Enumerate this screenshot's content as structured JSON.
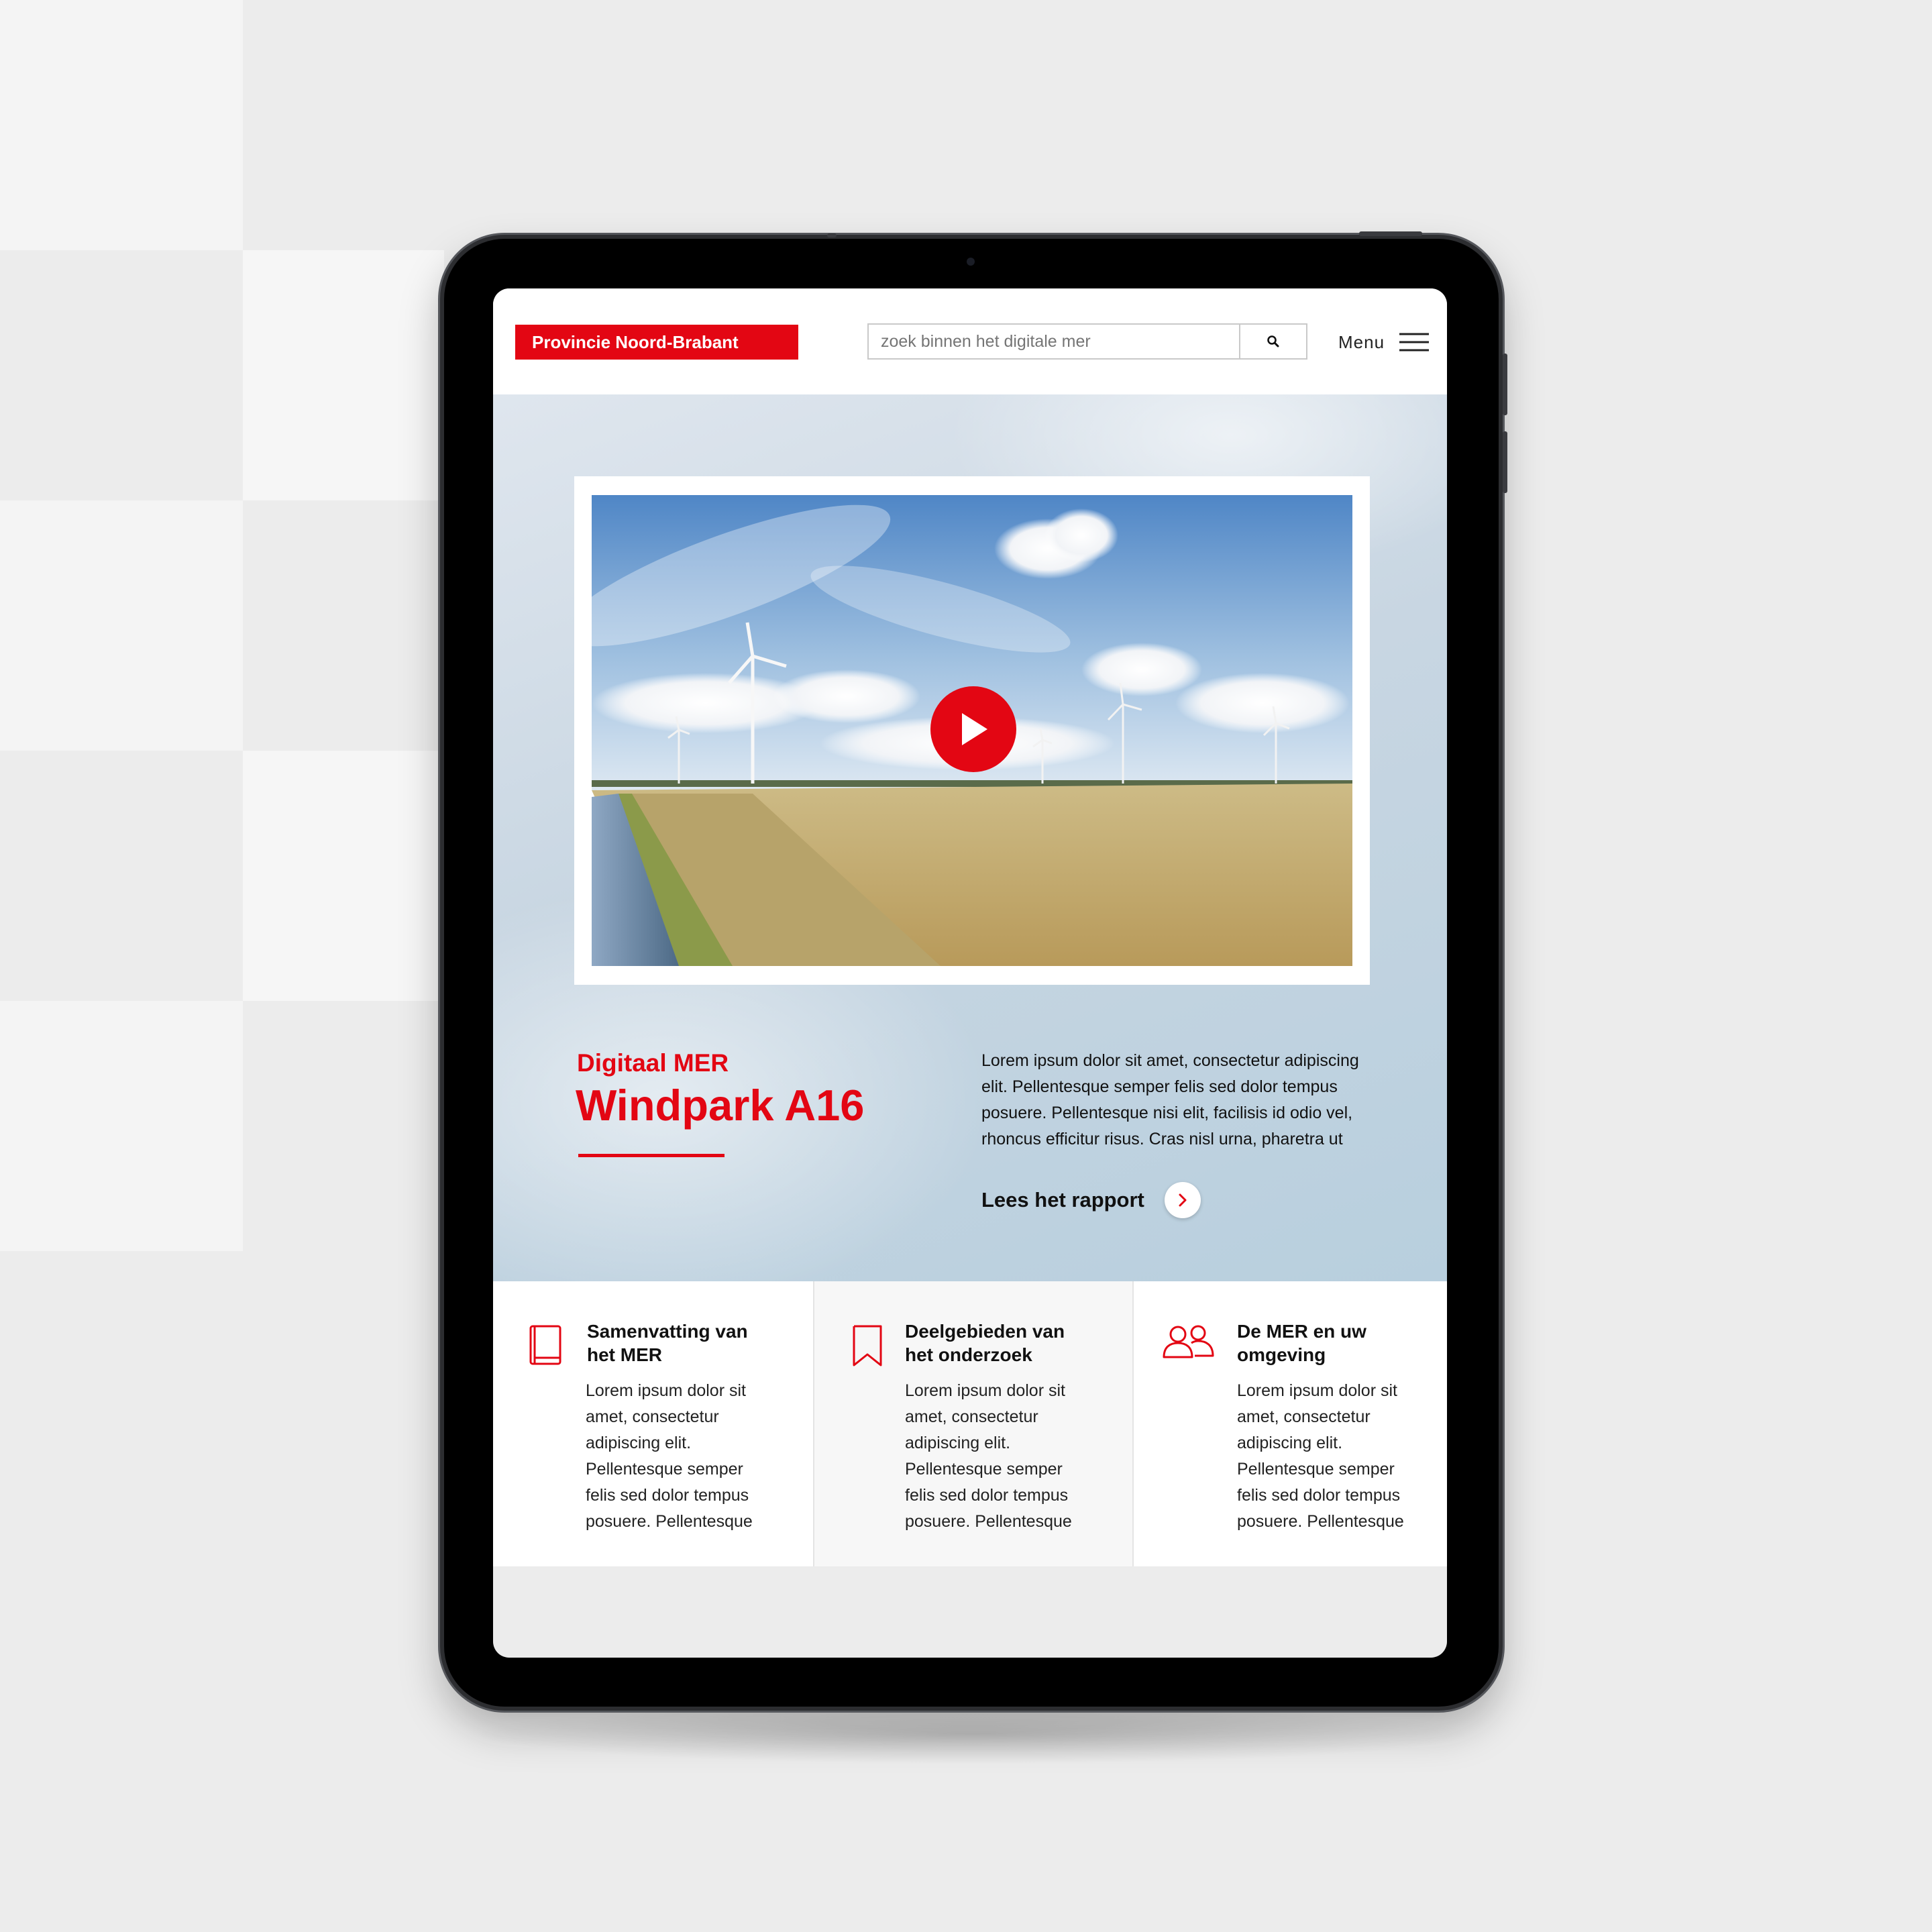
{
  "header": {
    "logo_text": "Provincie Noord-Brabant",
    "search_placeholder": "zoek binnen het digitale mer",
    "search_icon": "search-icon",
    "menu_label": "Menu",
    "menu_icon": "hamburger-icon"
  },
  "hero": {
    "video_play_icon": "play-icon",
    "subtitle": "Digitaal MER",
    "title": "Windpark A16",
    "body": "Lorem ipsum dolor sit amet, consectetur adipiscing elit. Pellentesque semper felis sed dolor tempus posuere. Pellentesque nisi elit, facilisis id odio vel, rhoncus efficitur risus. Cras nisl urna, pharetra ut",
    "link_label": "Lees het rapport",
    "link_icon": "chevron-right-icon"
  },
  "cards": [
    {
      "icon": "book-icon",
      "title": "Samenvatting van het MER",
      "text": "Lorem ipsum dolor sit amet, consectetur adipiscing elit. Pellentesque semper felis sed dolor tempus posuere. Pellentesque"
    },
    {
      "icon": "bookmark-icon",
      "title": "Deelgebieden van het onderzoek",
      "text": "Lorem ipsum dolor sit amet, consectetur adipiscing elit. Pellentesque semper felis sed dolor tempus posuere. Pellentesque"
    },
    {
      "icon": "people-icon",
      "title": "De MER en uw omgeving",
      "text": "Lorem ipsum dolor sit amet, consectetur adipiscing elit. Pellentesque semper felis sed dolor tempus posuere. Pellentesque"
    }
  ],
  "colors": {
    "brand_red": "#e30613",
    "background": "#ececec",
    "text": "#111111"
  }
}
